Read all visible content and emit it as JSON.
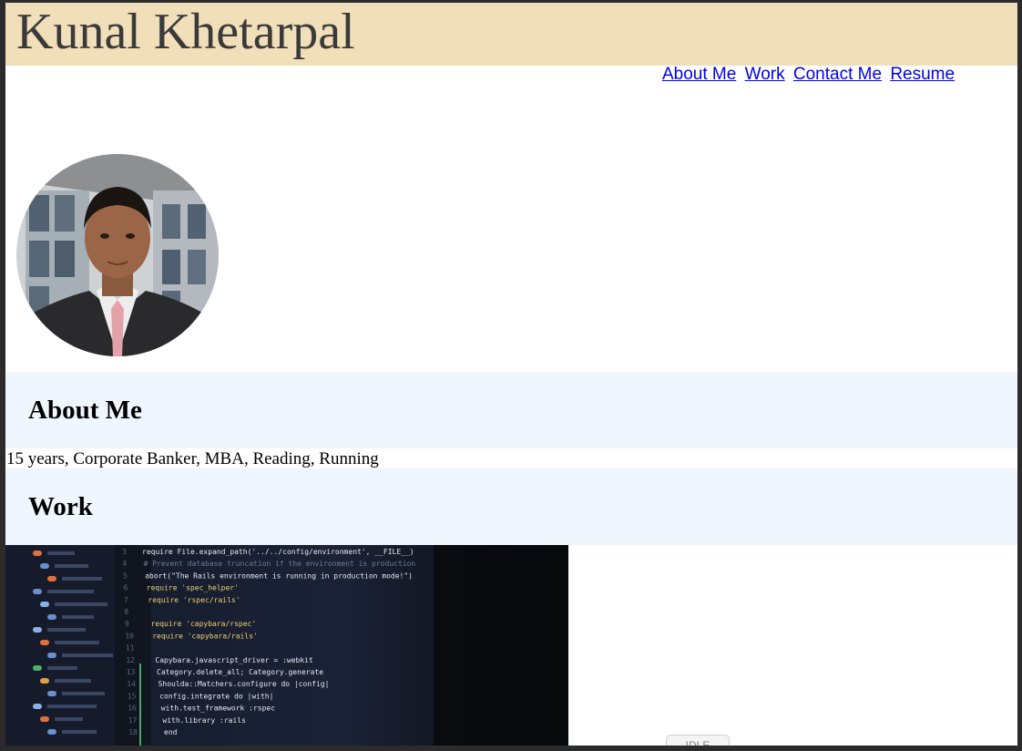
{
  "site": {
    "title": "Kunal Khetarpal"
  },
  "nav": {
    "items": [
      {
        "label": "About Me"
      },
      {
        "label": "Work"
      },
      {
        "label": "Contact Me"
      },
      {
        "label": "Resume"
      }
    ]
  },
  "profile": {
    "photo": "profile-photo"
  },
  "about": {
    "heading": "About Me",
    "text": "15 years, Corporate Banker, MBA, Reading, Running"
  },
  "work": {
    "heading": "Work",
    "image": "code-editor-photo",
    "code_lines": [
      {
        "num": "3",
        "text": "require File.expand_path('../../config/environment', __FILE__)"
      },
      {
        "num": "4",
        "text": "# Prevent database truncation if the environment is production"
      },
      {
        "num": "5",
        "text": "abort(\"The Rails environment is running in production mode!\")"
      },
      {
        "num": "6",
        "text": "require 'spec_helper'"
      },
      {
        "num": "7",
        "text": "require 'rspec/rails'"
      },
      {
        "num": "8",
        "text": ""
      },
      {
        "num": "9",
        "text": "require 'capybara/rspec'"
      },
      {
        "num": "10",
        "text": "require 'capybara/rails'"
      },
      {
        "num": "11",
        "text": ""
      },
      {
        "num": "12",
        "text": "Capybara.javascript_driver = :webkit"
      },
      {
        "num": "13",
        "text": "Category.delete_all; Category.generate"
      },
      {
        "num": "14",
        "text": "Shoulda::Matchers.configure do |config|"
      },
      {
        "num": "15",
        "text": "config.integrate do |with|"
      },
      {
        "num": "16",
        "text": "with.test_framework :rspec"
      },
      {
        "num": "17",
        "text": "with.library :rails"
      },
      {
        "num": "18",
        "text": "end"
      }
    ]
  },
  "status": {
    "idle_label": "IDLE"
  }
}
